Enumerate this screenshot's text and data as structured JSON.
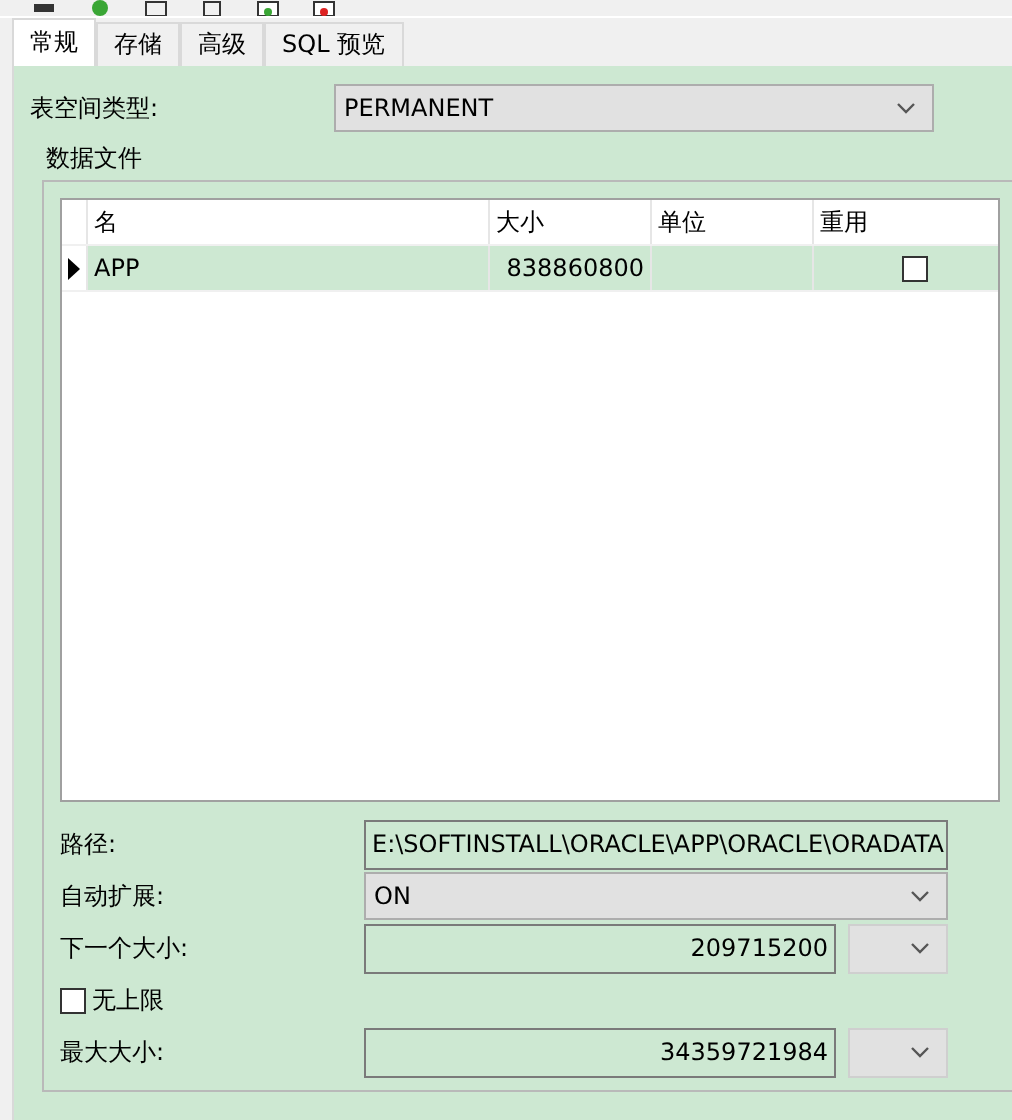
{
  "tabs": [
    {
      "label": "常规",
      "selected": true
    },
    {
      "label": "存储",
      "selected": false
    },
    {
      "label": "高级",
      "selected": false
    },
    {
      "label": "SQL 预览",
      "selected": false
    }
  ],
  "tablespace_type": {
    "label": "表空间类型:",
    "value": "PERMANENT"
  },
  "datafiles": {
    "title": "数据文件",
    "columns": [
      "名",
      "大小",
      "单位",
      "重用"
    ],
    "rows": [
      {
        "name": "APP",
        "size": "838860800",
        "unit": "",
        "reuse": false,
        "selected": true
      }
    ]
  },
  "fields": [
    {
      "kind": "text",
      "label": "路径:",
      "value": "E:\\SOFTINSTALL\\ORACLE\\APP\\ORACLE\\ORADATA"
    },
    {
      "kind": "select",
      "label": "自动扩展:",
      "value": "ON"
    },
    {
      "kind": "size",
      "label": "下一个大小:",
      "value": "209715200"
    },
    {
      "kind": "check",
      "label": "无上限",
      "checked": false
    },
    {
      "kind": "size",
      "label": "最大大小:",
      "value": "34359721984"
    }
  ]
}
